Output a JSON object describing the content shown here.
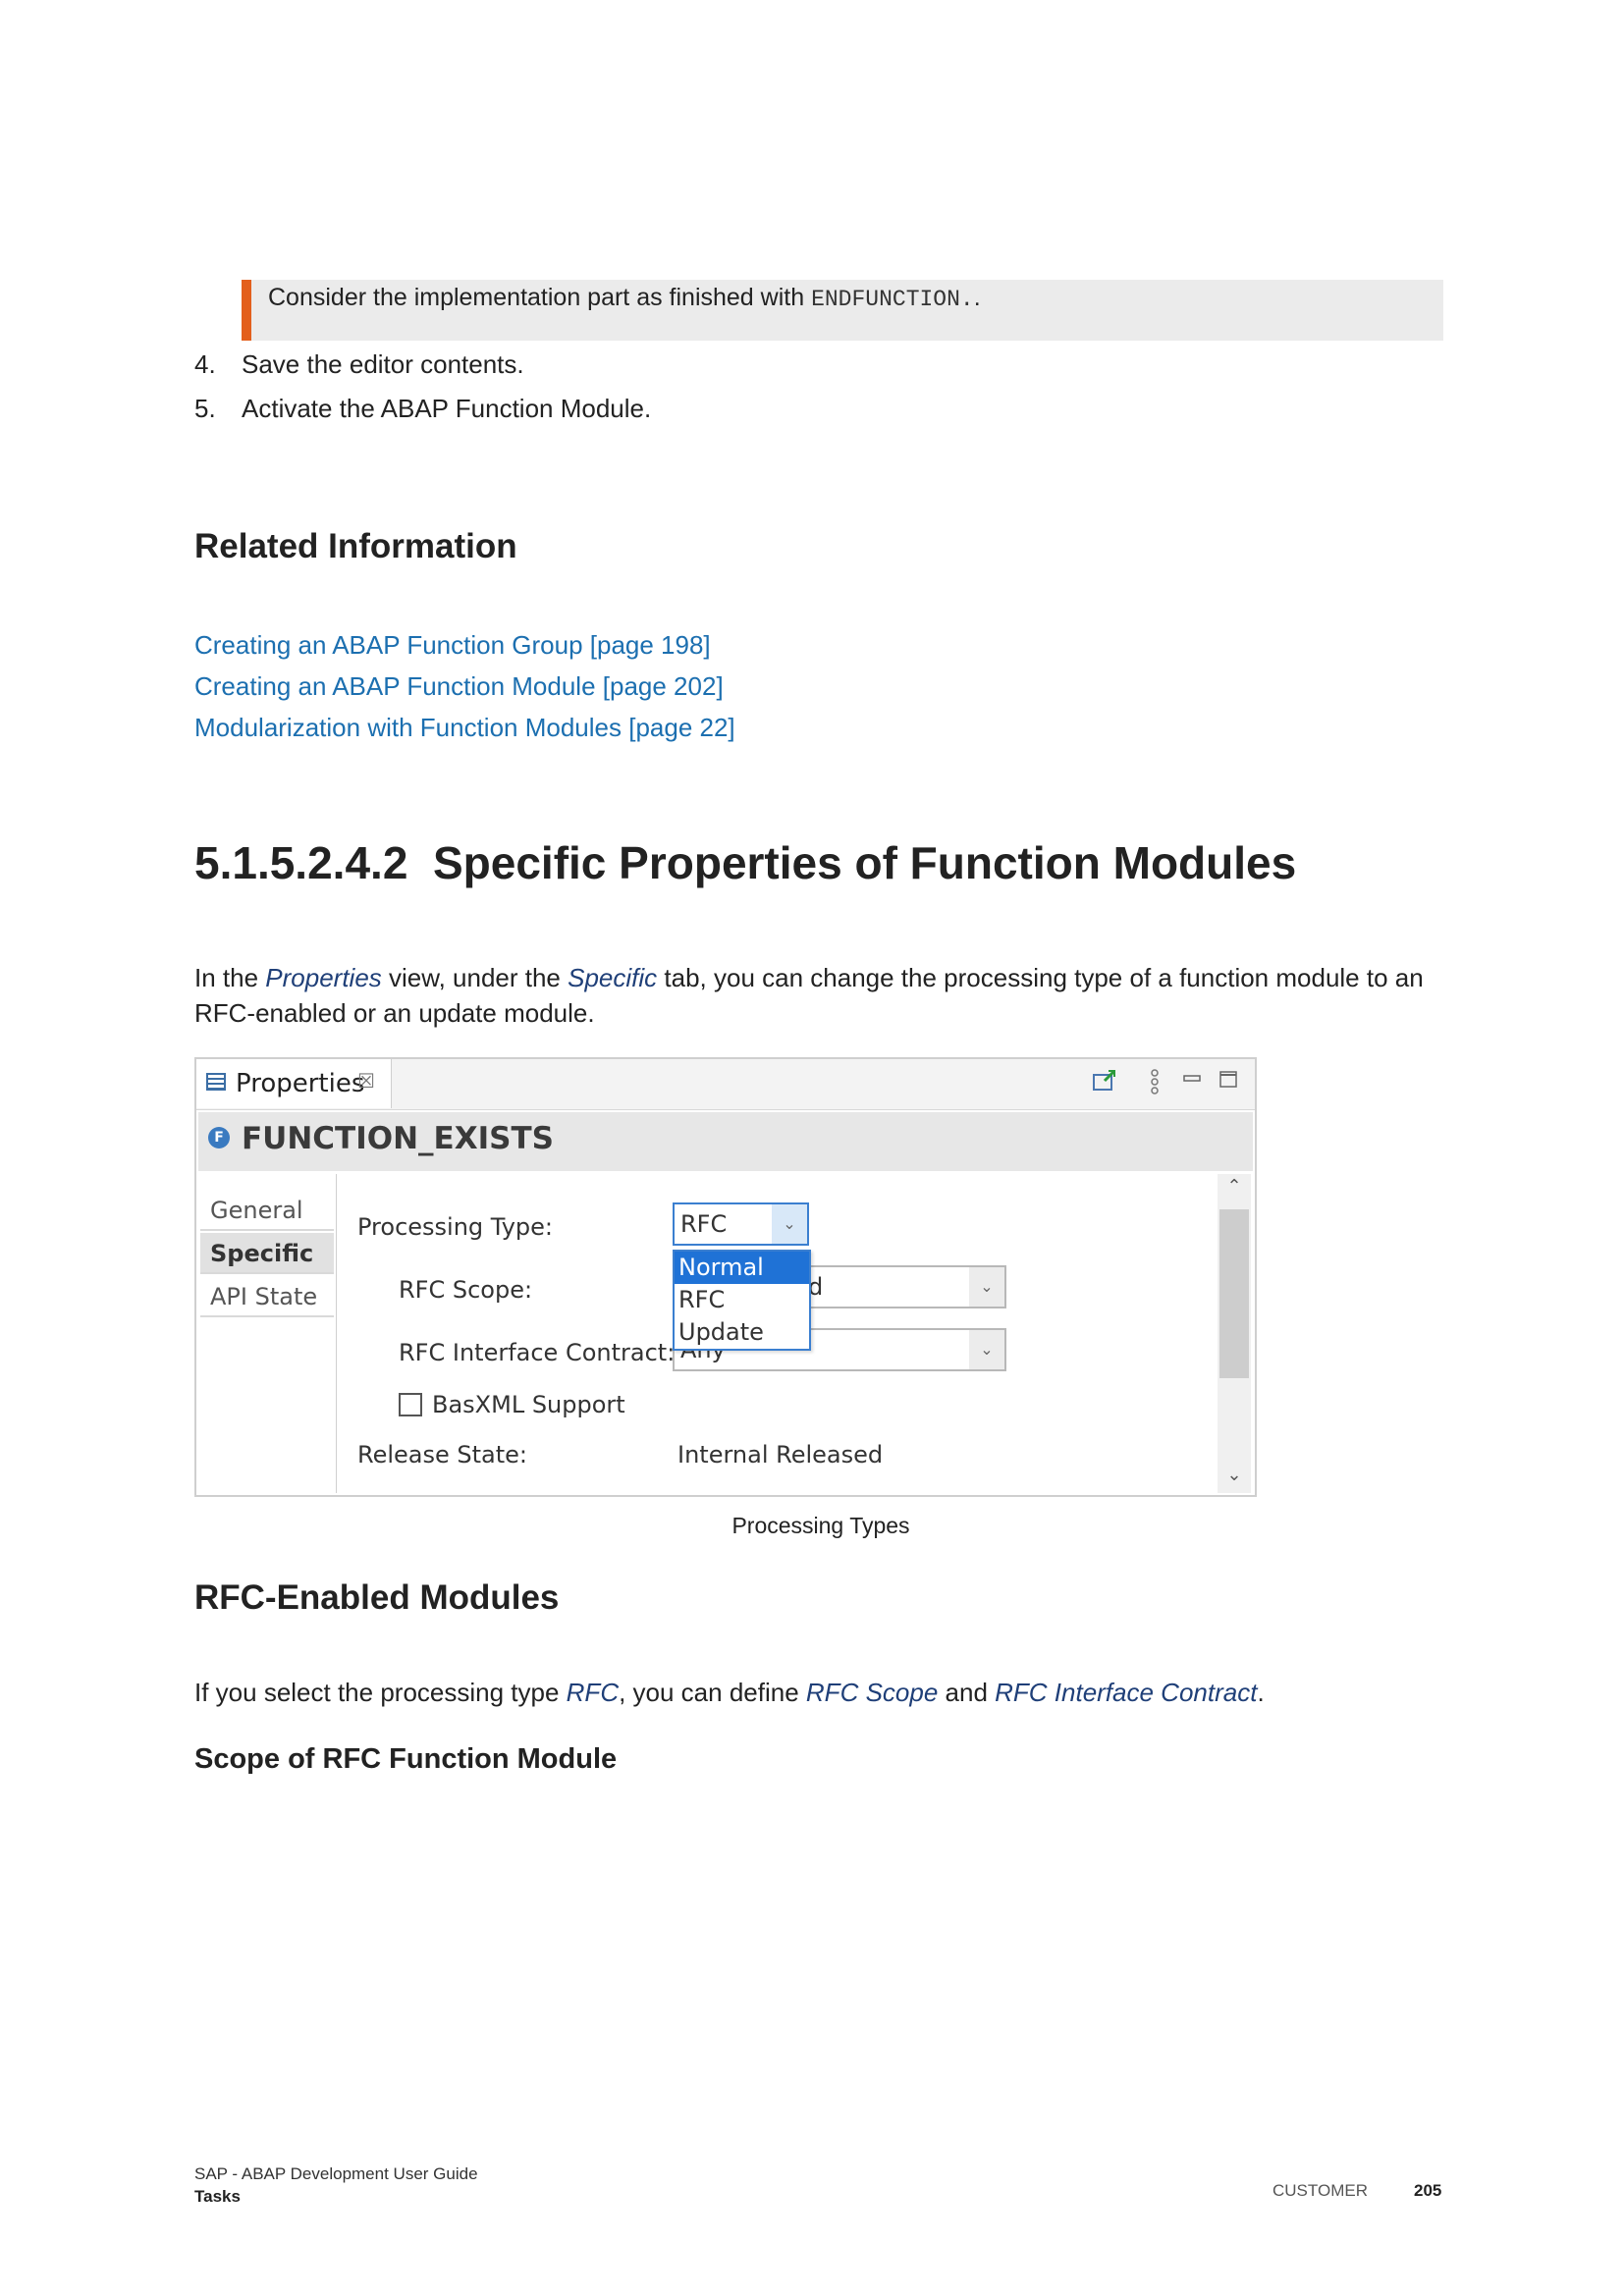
{
  "note": {
    "text_before": "Consider the implementation part as finished with ",
    "code": "ENDFUNCTION.",
    "text_after": "."
  },
  "steps": [
    {
      "num": "4.",
      "text": "Save the editor contents."
    },
    {
      "num": "5.",
      "text": "Activate the ABAP Function Module."
    }
  ],
  "related": {
    "title": "Related Information",
    "links": [
      "Creating an ABAP Function Group [page 198]",
      "Creating an ABAP Function Module [page 202]",
      "Modularization with Function Modules [page 22]"
    ]
  },
  "section": {
    "number": "5.1.5.2.4.2",
    "title": "Specific Properties of Function Modules"
  },
  "intro": {
    "t1": "In the ",
    "e1": "Properties",
    "t2": " view, under the ",
    "e2": "Specific",
    "t3": " tab, you can change the processing type of a function module to an RFC-enabled or an update module."
  },
  "screenshot": {
    "tab_label": "Properties",
    "tab_close": "☒",
    "function_name": "FUNCTION_EXISTS",
    "sidebar": [
      "General",
      "Specific",
      "API State"
    ],
    "processing_type_label": "Processing Type:",
    "processing_type_value": "RFC",
    "rfc_scope_label": "RFC Scope:",
    "rfc_scope_value_partial": "d",
    "rfc_interface_label": "RFC Interface Contract:",
    "rfc_interface_value": "Any",
    "dropdown_options": [
      "Normal",
      "RFC",
      "Update"
    ],
    "basxml_label": "BasXML Support",
    "basxml_checked": false,
    "release_state_label": "Release State:",
    "release_state_value": "Internal Released"
  },
  "caption": "Processing Types",
  "rfc_section": {
    "title": "RFC-Enabled Modules",
    "t1": "If you select the processing type ",
    "e1": "RFC",
    "t2": ", you can define ",
    "e2": "RFC Scope",
    "t3": " and ",
    "e3": "RFC Interface Contract",
    "t4": "."
  },
  "scope_title": "Scope of RFC Function Module",
  "footer": {
    "doc_title": "SAP - ABAP Development User Guide",
    "chapter": "Tasks",
    "audience": "CUSTOMER",
    "page": "205"
  }
}
